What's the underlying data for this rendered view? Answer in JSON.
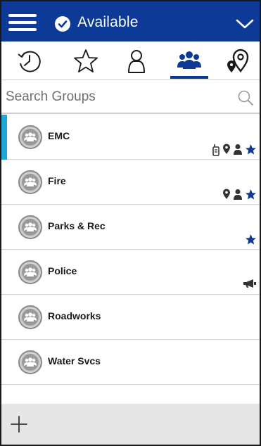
{
  "header": {
    "status_label": "Available",
    "menu_icon": "hamburger-menu-icon",
    "status_icon": "checkmark-circle-icon",
    "dropdown_icon": "chevron-down-icon",
    "background_color": "#0c3a96"
  },
  "tabs": [
    {
      "icon": "history-icon",
      "active": false
    },
    {
      "icon": "star-icon",
      "active": false
    },
    {
      "icon": "contact-icon",
      "active": false
    },
    {
      "icon": "groups-icon",
      "active": true
    },
    {
      "icon": "map-pins-icon",
      "active": false
    }
  ],
  "search": {
    "placeholder": "Search Groups",
    "icon": "search-icon"
  },
  "groups": [
    {
      "name": "EMC",
      "selected": true,
      "indicators": [
        "radio-icon",
        "location-pin-icon",
        "person-icon",
        "favorite-star-icon"
      ]
    },
    {
      "name": "Fire",
      "selected": false,
      "indicators": [
        "location-pin-icon",
        "person-icon",
        "favorite-star-icon"
      ]
    },
    {
      "name": "Parks & Rec",
      "selected": false,
      "indicators": [
        "favorite-star-icon"
      ]
    },
    {
      "name": "Police",
      "selected": false,
      "indicators": [
        "megaphone-icon"
      ]
    },
    {
      "name": "Roadworks",
      "selected": false,
      "indicators": []
    },
    {
      "name": "Water Svcs",
      "selected": false,
      "indicators": []
    }
  ],
  "footer": {
    "add_icon": "plus-icon"
  },
  "colors": {
    "accent": "#0c3a96",
    "selected_marker": "#1fa7d6",
    "star": "#0c3a96"
  }
}
